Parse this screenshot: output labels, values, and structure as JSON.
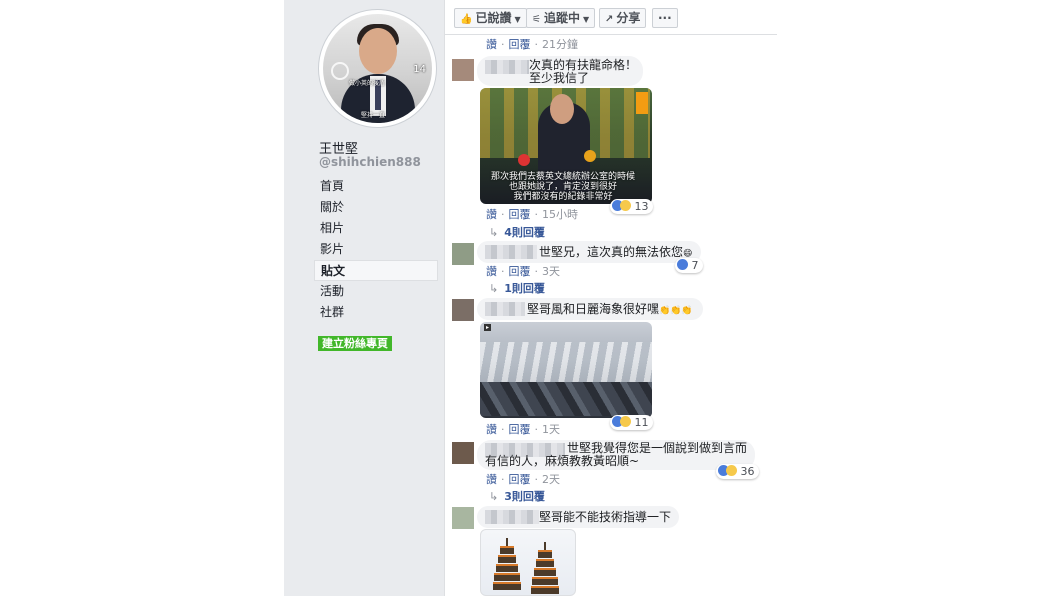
{
  "page": {
    "name": "王世堅",
    "handle": "@shihchien888",
    "avatar_text_1": "做小英的後盾",
    "avatar_text_2": "堅持一直",
    "avatar_badge": "14"
  },
  "sidebar": {
    "items": [
      {
        "label": "首頁",
        "active": false
      },
      {
        "label": "關於",
        "active": false
      },
      {
        "label": "相片",
        "active": false
      },
      {
        "label": "影片",
        "active": false
      },
      {
        "label": "貼文",
        "active": true
      },
      {
        "label": "活動",
        "active": false
      },
      {
        "label": "社群",
        "active": false
      }
    ],
    "create_page_label": "建立粉絲專頁"
  },
  "toolbar": {
    "liked_label": "已說讚",
    "follow_label": "追蹤中",
    "share_label": "分享",
    "more_label": "···"
  },
  "feed": {
    "top_actions": {
      "like": "讚",
      "reply": "回覆",
      "time": "21分鐘"
    },
    "comments": [
      {
        "text": "次真的有扶龍命格！\n至少我信了",
        "actions": {
          "like": "讚",
          "reply": "回覆",
          "time": "15小時"
        },
        "reactions": "13",
        "replies": "4則回覆",
        "image_caption": "那次我們去蔡英文總統辦公室的時候\n也跟她說了，肯定沒到很好\n我們都沒有的紀錄非常好"
      },
      {
        "text": "世堅兄，這次真的無法依您",
        "emoji": "😄",
        "actions": {
          "like": "讚",
          "reply": "回覆",
          "time": "3天"
        },
        "reactions": "7",
        "replies": "1則回覆"
      },
      {
        "text": "堅哥風和日麗海象很好嘿",
        "emoji": "👏👏👏",
        "actions": {
          "like": "讚",
          "reply": "回覆",
          "time": "1天"
        },
        "reactions": "11"
      },
      {
        "text": "世堅我覺得您是一個說到做到言而\n有信的人，麻煩教教黃昭順~",
        "actions": {
          "like": "讚",
          "reply": "回覆",
          "time": "2天"
        },
        "reactions": "36",
        "replies": "3則回覆"
      },
      {
        "text": "堅哥能不能技術指導一下"
      }
    ]
  },
  "colors": {
    "sidebar_bg": "#e9ebee",
    "link_blue": "#385898",
    "green_button": "#42b72a",
    "bubble_bg": "#f2f3f5"
  }
}
